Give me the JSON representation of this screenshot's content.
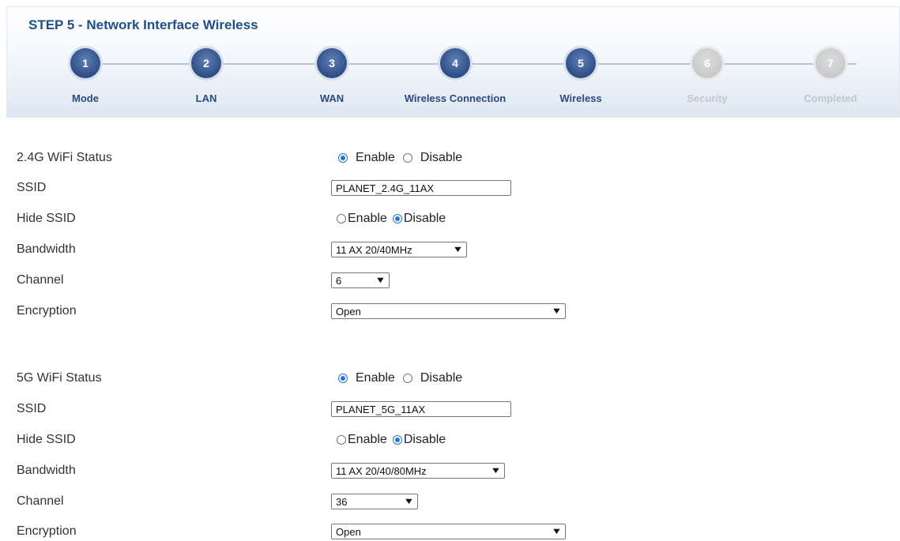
{
  "wizard": {
    "title": "STEP 5 - Network Interface Wireless",
    "steps": [
      {
        "number": "1",
        "label": "Mode",
        "state": "active"
      },
      {
        "number": "2",
        "label": "LAN",
        "state": "active"
      },
      {
        "number": "3",
        "label": "WAN",
        "state": "active"
      },
      {
        "number": "4",
        "label": "Wireless Connection",
        "state": "active"
      },
      {
        "number": "5",
        "label": "Wireless",
        "state": "active"
      },
      {
        "number": "6",
        "label": "Security",
        "state": "inactive"
      },
      {
        "number": "7",
        "label": "Completed",
        "state": "inactive"
      }
    ]
  },
  "wifi24": {
    "status_label": "2.4G WiFi Status",
    "status_enable": "Enable",
    "status_disable": "Disable",
    "status_selected": "Enable",
    "ssid_label": "SSID",
    "ssid_value": "PLANET_2.4G_11AX",
    "hide_ssid_label": "Hide SSID",
    "hide_enable": "Enable",
    "hide_disable": "Disable",
    "hide_selected": "Disable",
    "bandwidth_label": "Bandwidth",
    "bandwidth_value": "11 AX 20/40MHz",
    "channel_label": "Channel",
    "channel_value": "6",
    "encryption_label": "Encryption",
    "encryption_value": "Open"
  },
  "wifi5": {
    "status_label": "5G WiFi Status",
    "status_enable": "Enable",
    "status_disable": "Disable",
    "status_selected": "Enable",
    "ssid_label": "SSID",
    "ssid_value": "PLANET_5G_11AX",
    "hide_ssid_label": "Hide SSID",
    "hide_enable": "Enable",
    "hide_disable": "Disable",
    "hide_selected": "Disable",
    "bandwidth_label": "Bandwidth",
    "bandwidth_value": "11 AX 20/40/80MHz",
    "channel_label": "Channel",
    "channel_value": "36",
    "encryption_label": "Encryption",
    "encryption_value": "Open"
  },
  "colors": {
    "accent": "#2b4a7f",
    "inactive": "#c2c6cc",
    "radio_selected": "#2a73d6"
  }
}
